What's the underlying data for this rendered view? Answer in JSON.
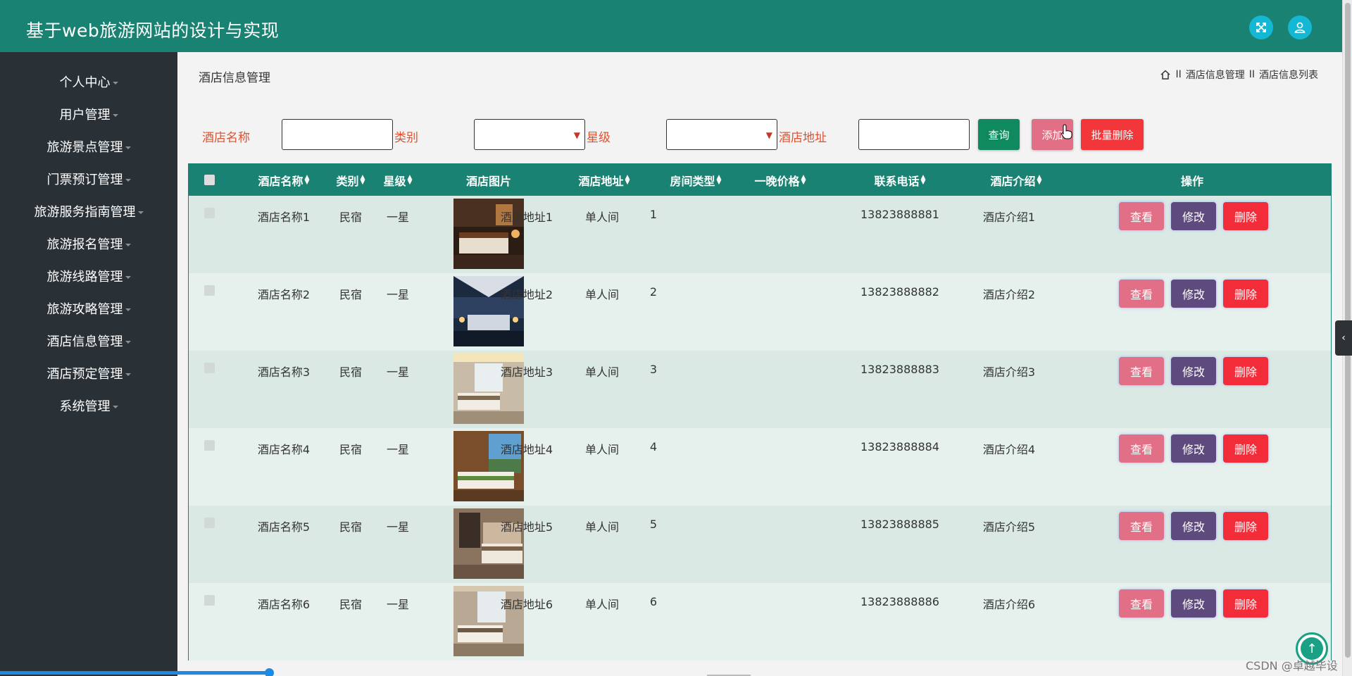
{
  "header": {
    "title": "基于web旅游网站的设计与实现",
    "bg_color": "#1a8272",
    "icons": [
      "fullscreen-icon",
      "user-icon"
    ]
  },
  "sidebar": {
    "items": [
      {
        "label": "个人中心"
      },
      {
        "label": "用户管理"
      },
      {
        "label": "旅游景点管理"
      },
      {
        "label": "门票预订管理"
      },
      {
        "label": "旅游服务指南管理"
      },
      {
        "label": "旅游报名管理"
      },
      {
        "label": "旅游线路管理"
      },
      {
        "label": "旅游攻略管理"
      },
      {
        "label": "酒店信息管理"
      },
      {
        "label": "酒店预定管理"
      },
      {
        "label": "系统管理"
      }
    ]
  },
  "page": {
    "title": "酒店信息管理",
    "breadcrumb": [
      "酒店信息管理",
      "酒店信息列表"
    ],
    "breadcrumb_sep": "II"
  },
  "search": {
    "hotel_name_label": "酒店名称",
    "hotel_name_value": "",
    "category_label": "类别",
    "category_value": "",
    "star_label": "星级",
    "star_value": "",
    "address_label": "酒店地址",
    "address_value": "",
    "query_button": "查询",
    "add_button": "添加",
    "batch_delete_button": "批量删除"
  },
  "table": {
    "columns": [
      "酒店名称",
      "类别",
      "星级",
      "酒店图片",
      "酒店地址",
      "房间类型",
      "一晚价格",
      "联系电话",
      "酒店介绍",
      "操作"
    ],
    "rows": [
      {
        "name": "酒店名称1",
        "category": "民宿",
        "star": "一星",
        "image": "hotel-room-photo",
        "address": "酒店地址1",
        "room_type": "单人间",
        "price": "1",
        "phone": "13823888881",
        "intro": "酒店介绍1"
      },
      {
        "name": "酒店名称2",
        "category": "民宿",
        "star": "一星",
        "image": "hotel-room-photo",
        "address": "酒店地址2",
        "room_type": "单人间",
        "price": "2",
        "phone": "13823888882",
        "intro": "酒店介绍2"
      },
      {
        "name": "酒店名称3",
        "category": "民宿",
        "star": "一星",
        "image": "hotel-room-photo",
        "address": "酒店地址3",
        "room_type": "单人间",
        "price": "3",
        "phone": "13823888883",
        "intro": "酒店介绍3"
      },
      {
        "name": "酒店名称4",
        "category": "民宿",
        "star": "一星",
        "image": "hotel-room-photo",
        "address": "酒店地址4",
        "room_type": "单人间",
        "price": "4",
        "phone": "13823888884",
        "intro": "酒店介绍4"
      },
      {
        "name": "酒店名称5",
        "category": "民宿",
        "star": "一星",
        "image": "hotel-room-photo",
        "address": "酒店地址5",
        "room_type": "单人间",
        "price": "5",
        "phone": "13823888885",
        "intro": "酒店介绍5"
      },
      {
        "name": "酒店名称6",
        "category": "民宿",
        "star": "一星",
        "image": "hotel-room-photo",
        "address": "酒店地址6",
        "room_type": "单人间",
        "price": "6",
        "phone": "13823888886",
        "intro": "酒店介绍6"
      }
    ],
    "actions": {
      "view": "查看",
      "edit": "修改",
      "delete": "删除"
    }
  },
  "watermark": "CSDN @卓越毕设",
  "colors": {
    "accent": "#1a8272",
    "sidebar": "#2a3136",
    "search_label": "#e0522f",
    "query": "#0f8a5e",
    "add": "#e16f86",
    "batch_delete": "#f2363a",
    "view": "#e16f86",
    "edit": "#5f4a7e",
    "delete": "#f22c39"
  }
}
